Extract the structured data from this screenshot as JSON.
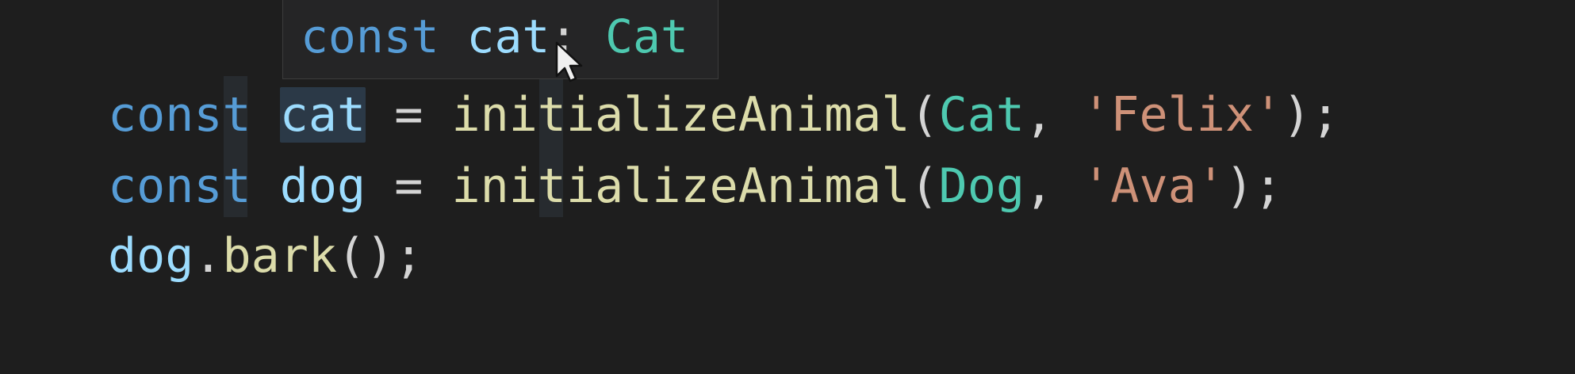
{
  "hover": {
    "keyword": "const",
    "identifier": "cat",
    "colon": ":",
    "type": "Cat"
  },
  "code": {
    "line1": {
      "keyword": "const",
      "identifier": "cat",
      "equals": "=",
      "function": "initializeAnimal",
      "open_paren": "(",
      "type_arg": "Cat",
      "comma": ",",
      "string_arg": "'Felix'",
      "close": ");"
    },
    "line2": {
      "keyword": "const",
      "identifier": "dog",
      "equals": "=",
      "function": "initializeAnimal",
      "open_paren": "(",
      "type_arg": "Dog",
      "comma": ",",
      "string_arg": "'Ava'",
      "close": ");"
    },
    "line3": {
      "object": "dog",
      "dot": ".",
      "method": "bark",
      "call": "();"
    }
  },
  "colors": {
    "background": "#1e1e1e",
    "keyword": "#569cd6",
    "variable": "#9cdcfe",
    "function": "#dcdcaa",
    "type": "#4ec9b0",
    "string": "#ce9178",
    "punctuation": "#d4d4d4"
  },
  "icons": {
    "pointer": "mouse-pointer-icon"
  }
}
